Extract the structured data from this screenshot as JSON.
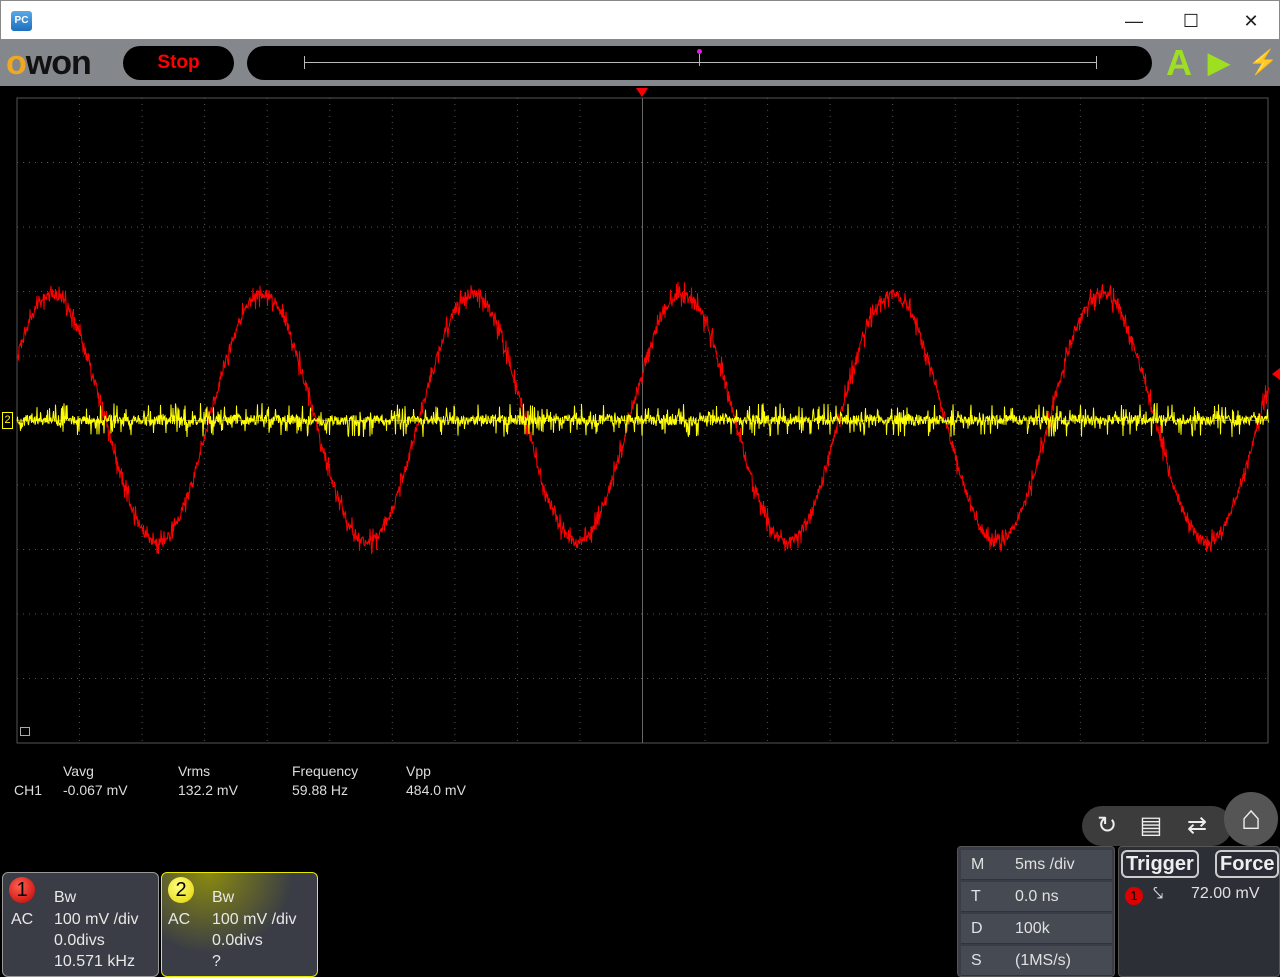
{
  "window": {
    "icon": "PC",
    "minimize": "—",
    "maximize": "☐",
    "close": "✕"
  },
  "toolbar": {
    "logo_o": "o",
    "logo_rest": "won",
    "run_state": "Stop",
    "auto_icon": "A",
    "run_icon": "▶",
    "force_icon": "⚡"
  },
  "measurements": {
    "channel": "CH1",
    "headers": [
      "Vavg",
      "Vrms",
      "Frequency",
      "Vpp"
    ],
    "values": [
      "-0.067 mV",
      "132.2 mV",
      "59.88 Hz",
      "484.0 mV"
    ]
  },
  "ch1": {
    "num": "1",
    "bw": "Bw",
    "coupling": "AC",
    "scale": "100 mV /div",
    "offset": "0.0divs",
    "freq": "10.571 kHz",
    "color": "#ff0000"
  },
  "ch2": {
    "num": "2",
    "bw": "Bw",
    "coupling": "AC",
    "scale": "100 mV /div",
    "offset": "0.0divs",
    "freq": "?",
    "color": "#ffff00"
  },
  "horizontal": {
    "rows": [
      {
        "k": "M",
        "v": "5ms /div"
      },
      {
        "k": "T",
        "v": "0.0 ns"
      },
      {
        "k": "D",
        "v": "100k"
      },
      {
        "k": "S",
        "v": "(1MS/s)"
      }
    ]
  },
  "trigger": {
    "label": "Trigger",
    "force": "Force",
    "source": "1",
    "level": "72.00 mV"
  },
  "markers": {
    "ch2_marker": "2"
  }
}
